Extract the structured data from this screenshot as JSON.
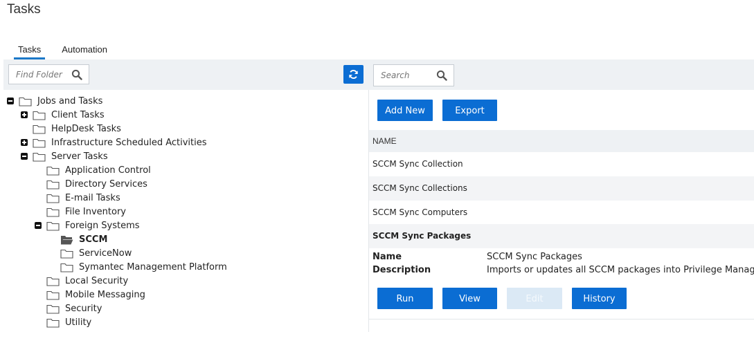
{
  "page": {
    "title": "Tasks"
  },
  "tabs": [
    {
      "label": "Tasks",
      "active": true
    },
    {
      "label": "Automation",
      "active": false
    }
  ],
  "toolbar": {
    "find_placeholder": "Find Folder",
    "search_placeholder": "Search",
    "accent": "#0b6dd3"
  },
  "tree": {
    "items": [
      {
        "label": "Jobs and Tasks",
        "toggle": "minus"
      },
      {
        "label": "Client Tasks",
        "toggle": "plus"
      },
      {
        "label": "HelpDesk Tasks",
        "toggle": "none"
      },
      {
        "label": "Infrastructure Scheduled Activities",
        "toggle": "plus"
      },
      {
        "label": "Server Tasks",
        "toggle": "minus"
      },
      {
        "label": "Application Control",
        "toggle": "none"
      },
      {
        "label": "Directory Services",
        "toggle": "none"
      },
      {
        "label": "E-mail Tasks",
        "toggle": "none"
      },
      {
        "label": "File Inventory",
        "toggle": "none"
      },
      {
        "label": "Foreign Systems",
        "toggle": "minus"
      },
      {
        "label": "SCCM",
        "toggle": "none",
        "selected": true,
        "icon": "open-folder-icon"
      },
      {
        "label": "ServiceNow",
        "toggle": "none"
      },
      {
        "label": "Symantec Management Platform",
        "toggle": "none"
      },
      {
        "label": "Local Security",
        "toggle": "none"
      },
      {
        "label": "Mobile Messaging",
        "toggle": "none"
      },
      {
        "label": "Security",
        "toggle": "none"
      },
      {
        "label": "Utility",
        "toggle": "none"
      }
    ]
  },
  "actions": {
    "add_new": "Add New",
    "export": "Export"
  },
  "grid": {
    "column": "NAME",
    "rows": [
      "SCCM Sync Collection",
      "SCCM Sync Collections",
      "SCCM Sync Computers",
      "SCCM Sync Packages"
    ],
    "selected_index": 3
  },
  "detail": {
    "name_label": "Name",
    "name_value": "SCCM Sync Packages",
    "description_label": "Description",
    "description_value": "Imports or updates all SCCM packages into Privilege Manager",
    "buttons": {
      "run": "Run",
      "view": "View",
      "edit": "Edit",
      "history": "History"
    }
  }
}
